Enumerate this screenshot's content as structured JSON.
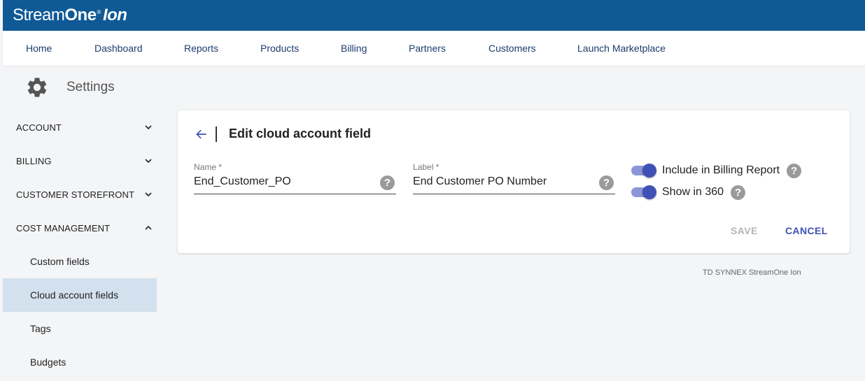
{
  "brand": {
    "part1": "Stream",
    "part2": "One",
    "reg": "®",
    "part3": "Ion"
  },
  "nav": {
    "items": [
      {
        "label": "Home"
      },
      {
        "label": "Dashboard"
      },
      {
        "label": "Reports"
      },
      {
        "label": "Products"
      },
      {
        "label": "Billing"
      },
      {
        "label": "Partners"
      },
      {
        "label": "Customers"
      },
      {
        "label": "Launch Marketplace"
      }
    ]
  },
  "settings": {
    "icon": "gear-icon",
    "title": "Settings"
  },
  "sidebar": {
    "sections": [
      {
        "label": "ACCOUNT",
        "expanded": false
      },
      {
        "label": "BILLING",
        "expanded": false
      },
      {
        "label": "CUSTOMER STOREFRONT",
        "expanded": false
      },
      {
        "label": "COST MANAGEMENT",
        "expanded": true
      }
    ],
    "subitems": [
      {
        "label": "Custom fields",
        "active": false
      },
      {
        "label": "Cloud account fields",
        "active": true
      },
      {
        "label": "Tags",
        "active": false
      },
      {
        "label": "Budgets",
        "active": false
      }
    ]
  },
  "card": {
    "title": "Edit cloud account field",
    "name_field": {
      "label": "Name *",
      "value": "End_Customer_PO"
    },
    "label_field": {
      "label": "Label *",
      "value": "End Customer PO Number"
    },
    "help_glyph": "?",
    "toggles": [
      {
        "label": "Include in Billing Report",
        "on": true
      },
      {
        "label": "Show in 360",
        "on": true
      }
    ],
    "save_label": "SAVE",
    "cancel_label": "CANCEL"
  },
  "footer": {
    "text": "TD SYNNEX StreamOne Ion"
  },
  "colors": {
    "brand_bar": "#0f5996",
    "nav_text": "#1d3b6e",
    "accent": "#3f51b5",
    "active_sidebar": "#d3e0ed",
    "page_bg": "#f4f5f7"
  }
}
